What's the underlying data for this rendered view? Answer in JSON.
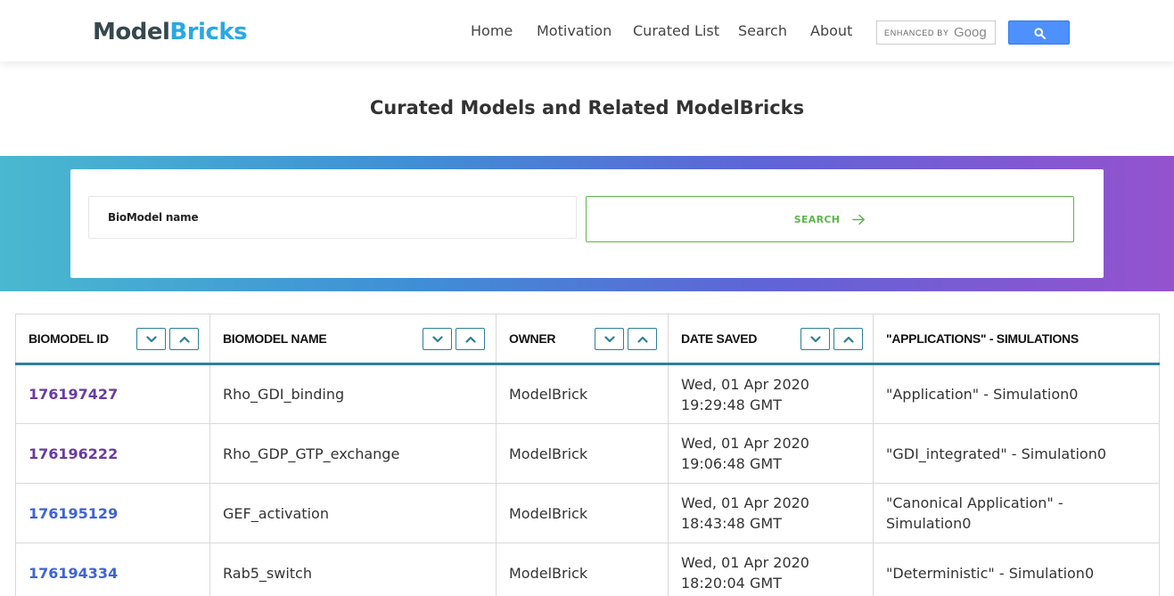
{
  "header": {
    "logo_part1": "Model",
    "logo_part2": "Bricks",
    "nav": [
      "Home",
      "Motivation",
      "Curated List",
      "Search",
      "About"
    ],
    "search_enhanced": "ENHANCED BY",
    "search_google": "Goog"
  },
  "page_title": "Curated Models and Related ModelBricks",
  "search": {
    "placeholder": "BioModel name",
    "button_label": "SEARCH"
  },
  "table": {
    "columns": [
      "BIOMODEL ID",
      "BIOMODEL NAME",
      "OWNER",
      "DATE SAVED",
      "\"APPLICATIONS\" - SIMULATIONS"
    ],
    "rows": [
      {
        "id": "176197427",
        "name": "Rho_GDI_binding",
        "owner": "ModelBrick",
        "date": "Wed, 01 Apr 2020 19:29:48 GMT",
        "apps": "\"Application\" - Simulation0"
      },
      {
        "id": "176196222",
        "name": "Rho_GDP_GTP_exchange",
        "owner": "ModelBrick",
        "date": "Wed, 01 Apr 2020 19:06:48 GMT",
        "apps": "\"GDI_integrated\" - Simulation0"
      },
      {
        "id": "176195129",
        "name": "GEF_activation",
        "owner": "ModelBrick",
        "date": "Wed, 01 Apr 2020 18:43:48 GMT",
        "apps": "\"Canonical Application\" - Simulation0"
      },
      {
        "id": "176194334",
        "name": "Rab5_switch",
        "owner": "ModelBrick",
        "date": "Wed, 01 Apr 2020 18:20:04 GMT",
        "apps": "\"Deterministic\" - Simulation0"
      }
    ]
  },
  "colors": {
    "logo_dark": "#37474f",
    "logo_accent": "#29a9e1",
    "search_green": "#5db64c",
    "table_accent": "#2d7f9a",
    "link_visited": "#6a3aa1",
    "link": "#3b64d6"
  }
}
